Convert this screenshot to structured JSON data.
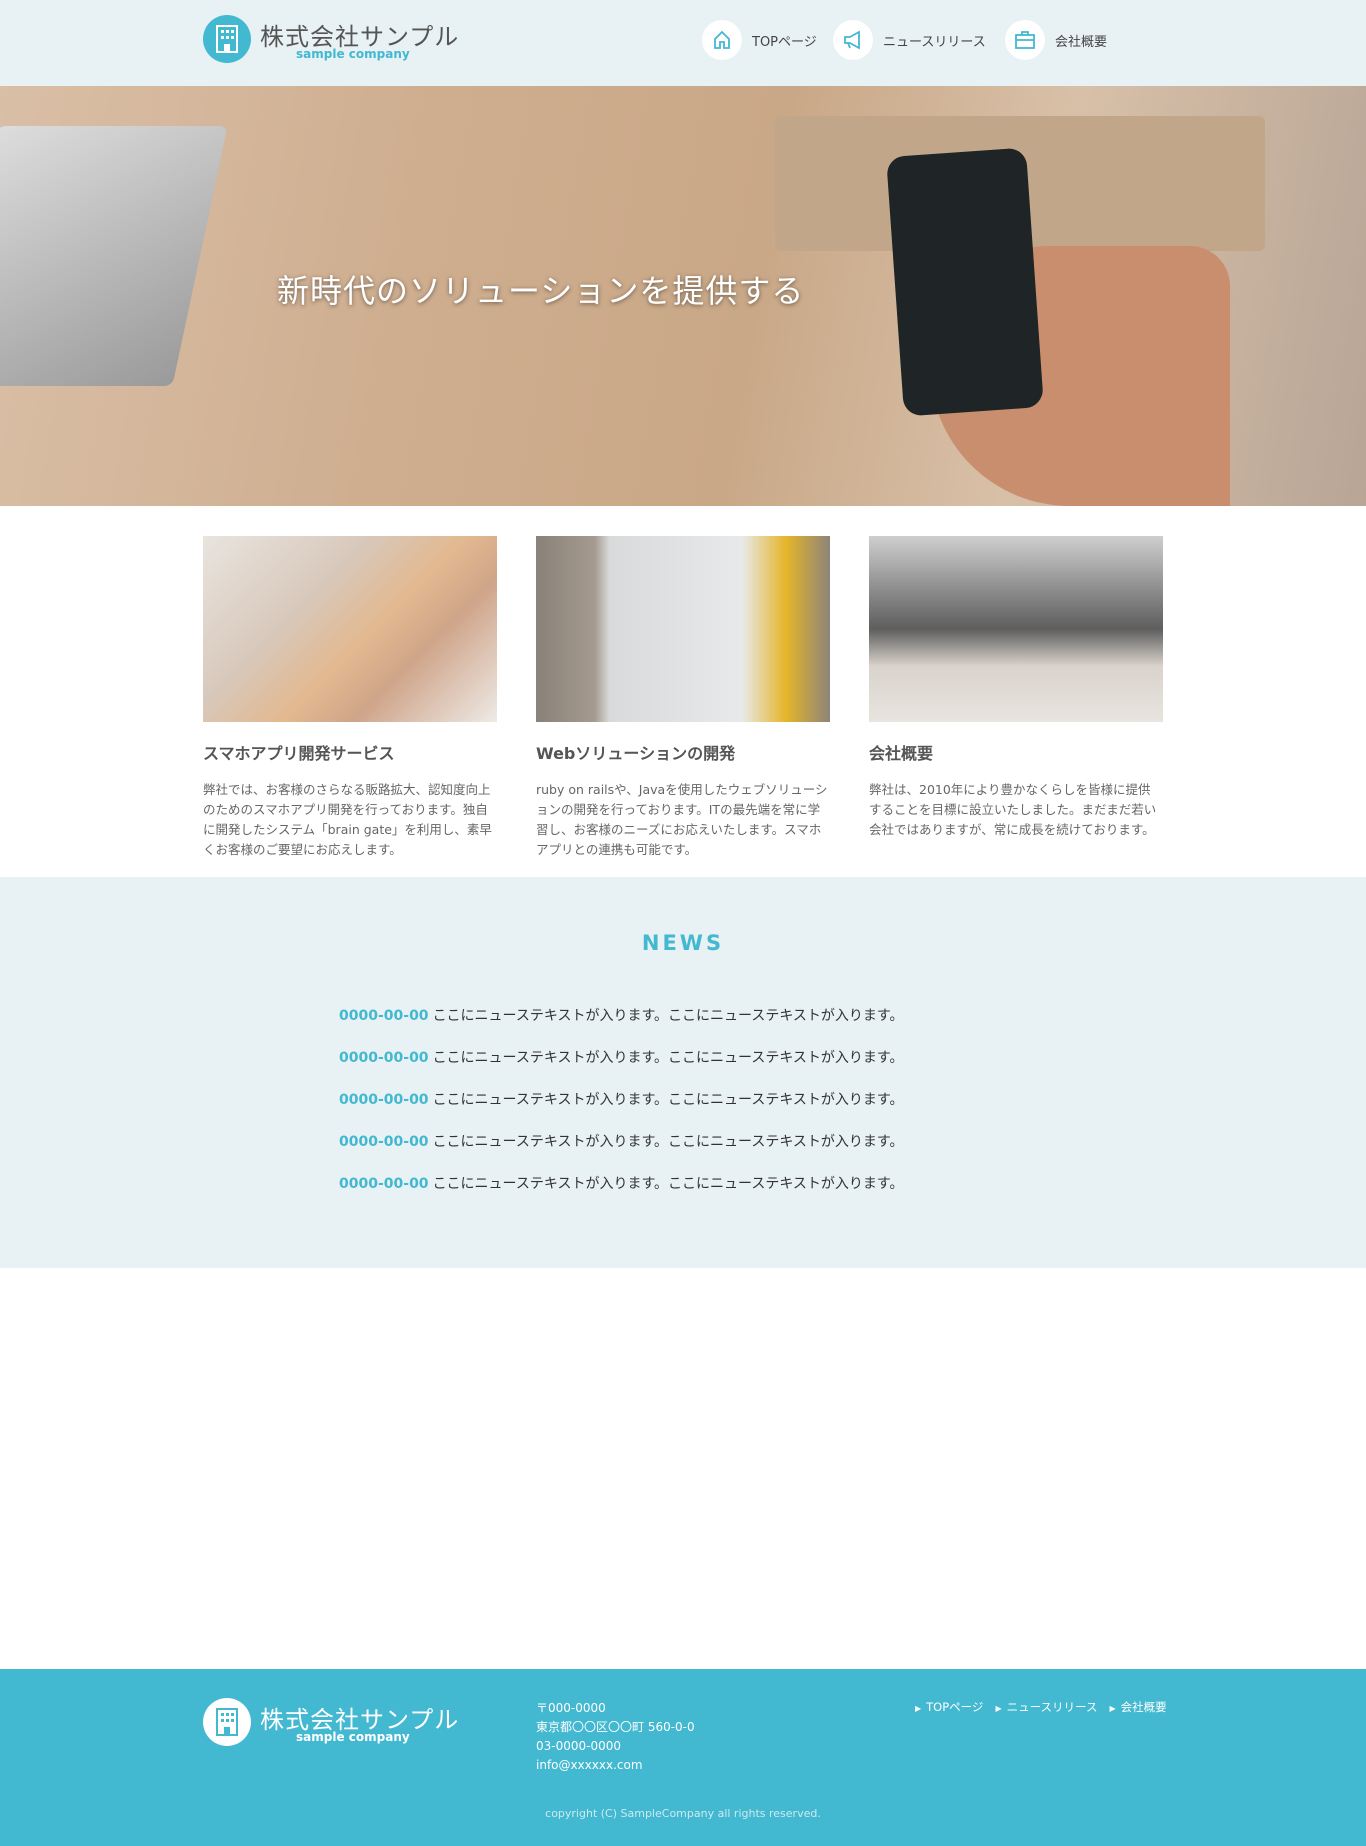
{
  "header": {
    "logo_title": "株式会社サンプル",
    "logo_sub": "sample company",
    "nav": [
      {
        "label": "TOPページ",
        "icon": "home-icon"
      },
      {
        "label": "ニュースリリース",
        "icon": "megaphone-icon"
      },
      {
        "label": "会社概要",
        "icon": "briefcase-icon"
      }
    ]
  },
  "hero": {
    "tagline": "新時代のソリューションを提供する"
  },
  "cards": [
    {
      "title": "スマホアプリ開発サービス",
      "text": "弊社では、お客様のさらなる販路拡大、認知度向上のためのスマホアプリ開発を行っております。独自に開発したシステム「brain gate」を利用し、素早くお客様のご要望にお応えします。"
    },
    {
      "title": "Webソリューションの開発",
      "text": "ruby on railsや、Javaを使用したウェブソリューションの開発を行っております。ITの最先端を常に学習し、お客様のニーズにお応えいたします。スマホアプリとの連携も可能です。"
    },
    {
      "title": "会社概要",
      "text": "弊社は、2010年により豊かなくらしを皆様に提供することを目標に設立いたしました。まだまだ若い会社ではありますが、常に成長を続けております。"
    }
  ],
  "news": {
    "title": "NEWS",
    "items": [
      {
        "date": "0000-00-00",
        "text": "ここにニューステキストが入ります。ここにニューステキストが入ります。"
      },
      {
        "date": "0000-00-00",
        "text": "ここにニューステキストが入ります。ここにニューステキストが入ります。"
      },
      {
        "date": "0000-00-00",
        "text": "ここにニューステキストが入ります。ここにニューステキストが入ります。"
      },
      {
        "date": "0000-00-00",
        "text": "ここにニューステキストが入ります。ここにニューステキストが入ります。"
      },
      {
        "date": "0000-00-00",
        "text": "ここにニューステキストが入ります。ここにニューステキストが入ります。"
      }
    ]
  },
  "footer": {
    "logo_title": "株式会社サンプル",
    "logo_sub": "sample company",
    "postal": "〒000-0000",
    "address": "東京都〇〇区〇〇町 560-0-0",
    "phone": "03-0000-0000",
    "email": "info@xxxxxx.com",
    "links": [
      "TOPページ",
      "ニュースリリース",
      "会社概要"
    ],
    "copyright": "copyright (C) SampleCompany all rights reserved."
  },
  "colors": {
    "accent": "#42b8d1",
    "header_bg": "#e8f1f3"
  }
}
